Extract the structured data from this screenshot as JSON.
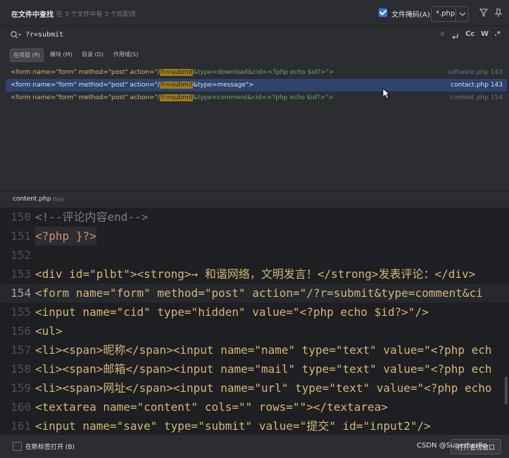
{
  "header": {
    "title": "在文件中查找",
    "count": "在 3 个文件中有 3 个匹配项",
    "file_mask_label": "文件掩码(A):",
    "file_mask_checked": true,
    "file_mask_value": "*.php"
  },
  "search": {
    "query": "?r=submit",
    "options": {
      "match_case": "Cc",
      "words": "W",
      "regex": ".*"
    }
  },
  "scopes": [
    {
      "label": "在项目 (P)",
      "active": true
    },
    {
      "label": "模块 (M)",
      "active": false
    },
    {
      "label": "目录 (D)",
      "active": false
    },
    {
      "label": "作用域(S)",
      "active": false
    }
  ],
  "results": [
    {
      "pre": "<form name=\"form\" method=\"post\" action=\"/",
      "match": "?r=submit",
      "post": "&type=download&cid=<?php echo $id?>\">",
      "file": "software.php 143",
      "selected": false
    },
    {
      "pre": "<form name=\"form\" method=\"post\" action=\"/",
      "match": "?r=submit",
      "post": "&type=message\">",
      "file": "contact.php 143",
      "selected": true
    },
    {
      "pre": "<form name=\"form\" method=\"post\" action=\"/",
      "match": "?r=submit",
      "post": "&type=comment&cid=<?php echo $id?>\">",
      "file": "content.php 154",
      "selected": false
    }
  ],
  "preview": {
    "file_name": "content.php",
    "dir": "files",
    "lines": [
      {
        "n": "150",
        "t": "<!--评论内容end-->"
      },
      {
        "n": "151",
        "t": "<?php }?>"
      },
      {
        "n": "152",
        "t": ""
      },
      {
        "n": "153",
        "t": "<div id=\"plbt\"><strong>→ 和谐网络，文明发言！</strong>发表评论：</div>"
      },
      {
        "n": "154",
        "t": "<form  name=\"form\" method=\"post\" action=\"/?r=submit&type=comment&ci"
      },
      {
        "n": "155",
        "t": "<input name=\"cid\" type=\"hidden\" value=\"<?php echo $id?>\"/>"
      },
      {
        "n": "156",
        "t": "<ul>"
      },
      {
        "n": "157",
        "t": "<li><span>昵称</span><input name=\"name\" type=\"text\" value=\"<?php ech"
      },
      {
        "n": "158",
        "t": "<li><span>邮箱</span><input name=\"mail\" type=\"text\" value=\"<?php ech"
      },
      {
        "n": "159",
        "t": "<li><span>网址</span><input name=\"url\" type=\"text\" value=\"<?php echo"
      },
      {
        "n": "160",
        "t": "<textarea name=\"content\" cols=\"\" rows=\"\"></textarea>"
      },
      {
        "n": "161",
        "t": "<input name=\"save\" type=\"submit\"  value=\"提交\" id=\"input2\"/>"
      }
    ],
    "current_line": "154"
  },
  "footer": {
    "new_tab_label": "在新标签打开 (B)",
    "open_button": "打开查找窗口",
    "watermark": "CSDN @SuperherRo"
  },
  "colors": {
    "accent": "#3574f0",
    "selection": "#2e436e",
    "match_highlight": "#a07c1a",
    "string": "#6aab73",
    "tag": "#d5b778"
  }
}
